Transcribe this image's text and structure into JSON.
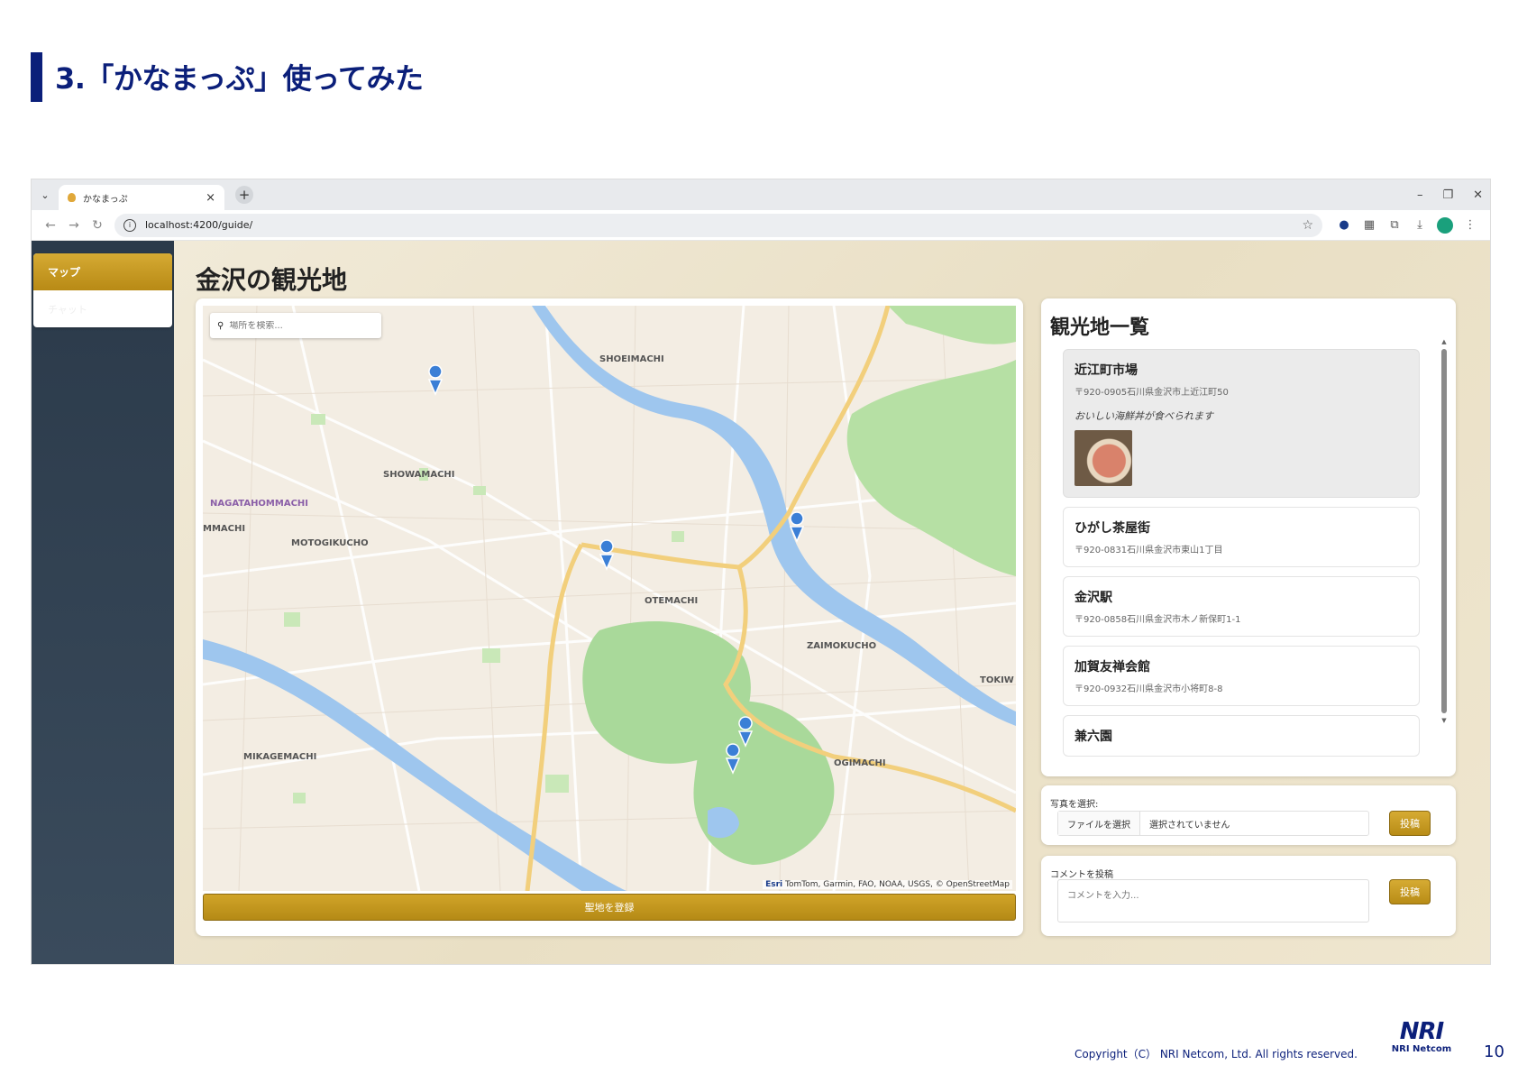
{
  "slide": {
    "title": "3.「かなまっぷ」使ってみた",
    "copyright": "Copyright（C） NRI Netcom, Ltd. All rights reserved.",
    "logo_main": "NRI",
    "logo_sub": "NRI Netcom",
    "page_number": "10",
    "accent_color": "#0b1f7a"
  },
  "browser": {
    "tab_title": "かなまっぷ",
    "url": "localhost:4200/guide/",
    "new_tab_label": "+",
    "close_label": "×"
  },
  "app": {
    "sidebar": {
      "items": [
        {
          "label": "マップ",
          "active": true
        },
        {
          "label": "チャット",
          "active": false
        }
      ]
    },
    "page_title": "金沢の観光地",
    "map": {
      "search_placeholder": "場所を検索...",
      "labels": [
        "SHOEIMACHI",
        "SHOWAMACHI",
        "NAGATAHOMMACHI",
        "MMACHI",
        "MOTOGIKUCHO",
        "OTEMACHI",
        "ZAIMOKUCHO",
        "MIKAGEMACHI",
        "OGIMACHI",
        "TOKIW"
      ],
      "attribution_brand": "Esri",
      "attribution": "TomTom, Garmin, FAO, NOAA, USGS, © OpenStreetMap",
      "register_button": "聖地を登録",
      "accent_color": "#c69b22"
    },
    "spot_list": {
      "title": "観光地一覧",
      "items": [
        {
          "name": "近江町市場",
          "address": "〒920-0905石川県金沢市上近江町50",
          "description": "おいしい海鮮丼が食べられます",
          "has_photo": true,
          "selected": true
        },
        {
          "name": "ひがし茶屋街",
          "address": "〒920-0831石川県金沢市東山1丁目"
        },
        {
          "name": "金沢駅",
          "address": "〒920-0858石川県金沢市木ノ新保町1-1"
        },
        {
          "name": "加賀友禅会館",
          "address": "〒920-0932石川県金沢市小将町8-8"
        },
        {
          "name": "兼六園",
          "address": ""
        }
      ]
    },
    "upload": {
      "label": "写真を選択:",
      "file_button": "ファイルを選択",
      "file_status": "選択されていません",
      "post_button": "投稿"
    },
    "comment": {
      "label": "コメントを投稿",
      "placeholder": "コメントを入力...",
      "post_button": "投稿"
    }
  }
}
